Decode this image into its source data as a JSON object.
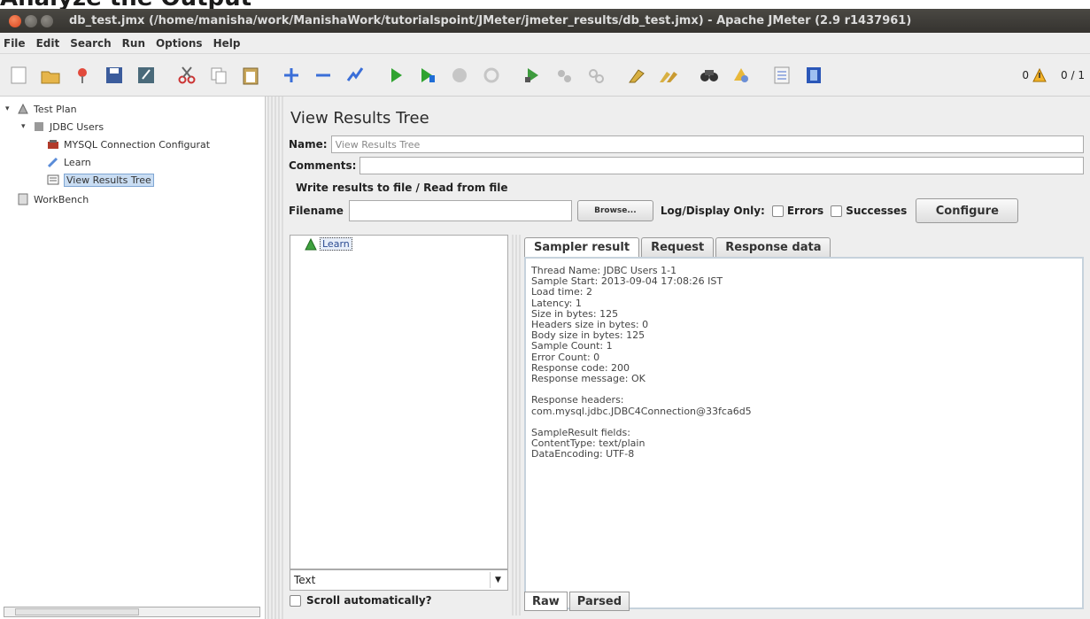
{
  "heading": {
    "text": "Analyze the Output"
  },
  "window": {
    "title": "db_test.jmx (/home/manisha/work/ManishaWork/tutorialspoint/JMeter/jmeter_results/db_test.jmx) - Apache JMeter (2.9 r1437961)"
  },
  "menu": [
    "File",
    "Edit",
    "Search",
    "Run",
    "Options",
    "Help"
  ],
  "toolbar": {
    "icons": [
      "new-icon",
      "open-icon",
      "templates-icon",
      "save-icon",
      "save-as-icon",
      "cut-icon",
      "copy-icon",
      "paste-icon",
      "expand-icon",
      "collapse-icon",
      "toggle-icon",
      "start-icon",
      "start-no-pause-icon",
      "stop-icon",
      "shutdown-icon",
      "remote-start-icon",
      "remote-stop-icon",
      "remote-shutdown-icon",
      "clear-icon",
      "clear-all-icon",
      "search-icon",
      "reset-search-icon",
      "function-helper-icon",
      "help-icon"
    ],
    "warning_count": "0",
    "thread_count": "0 / 1"
  },
  "tree": {
    "test_plan": "Test Plan",
    "jdbc_users": "JDBC Users",
    "mysql_config": "MYSQL Connection Configurat",
    "learn": "Learn",
    "view_results_tree": "View Results Tree",
    "workbench": "WorkBench"
  },
  "panel": {
    "title": "View Results Tree",
    "name_label": "Name:",
    "name_value": "View Results Tree",
    "comments_label": "Comments:",
    "write_results_label": "Write results to file / Read from file",
    "filename_label": "Filename",
    "browse_label": "Browse...",
    "log_display_label": "Log/Display Only:",
    "errors_label": "Errors",
    "successes_label": "Successes",
    "configure_label": "Configure"
  },
  "results": {
    "sample_node": "Learn",
    "renderer": "Text",
    "scroll_auto_label": "Scroll automatically?",
    "tabs": [
      "Sampler result",
      "Request",
      "Response data"
    ],
    "bottom_tabs": [
      "Raw",
      "Parsed"
    ],
    "lines": [
      "Thread Name: JDBC Users 1-1",
      "Sample Start: 2013-09-04 17:08:26 IST",
      "Load time: 2",
      "Latency: 1",
      "Size in bytes: 125",
      "Headers size in bytes: 0",
      "Body size in bytes: 125",
      "Sample Count: 1",
      "Error Count: 0",
      "Response code: 200",
      "Response message: OK",
      "",
      "Response headers:",
      "com.mysql.jdbc.JDBC4Connection@33fca6d5",
      "",
      "SampleResult fields:",
      "ContentType: text/plain",
      "DataEncoding: UTF-8"
    ]
  }
}
